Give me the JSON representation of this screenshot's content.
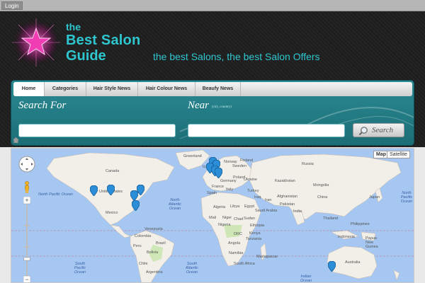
{
  "topbar": {
    "login_label": "Login"
  },
  "logo": {
    "line_the": "the",
    "line_1": "Best Salon",
    "line_2": "Guide",
    "icon": "pink-star-logo"
  },
  "tagline": "the best Salons, the best Salon Offers",
  "nav": [
    {
      "label": "Home",
      "active": true
    },
    {
      "label": "Categories",
      "active": false
    },
    {
      "label": "Hair Style News",
      "active": false
    },
    {
      "label": "Hair Colour News",
      "active": false
    },
    {
      "label": "Beaufy News",
      "active": false
    }
  ],
  "search": {
    "search_for_label": "Search For",
    "near_label": "Near",
    "near_hint": "(city, country)",
    "search_for_value": "",
    "near_value": "",
    "button_label": "Search"
  },
  "map": {
    "type_buttons": [
      "Map",
      "Satellite"
    ],
    "active_type": "Map",
    "oceans": [
      "North Pacific Ocean",
      "North Atlantic Ocean",
      "South Atlantic Ocean",
      "Indian Ocean",
      "North Pacific Ocean",
      "South Pacific Ocean"
    ],
    "countries": [
      "Canada",
      "United States",
      "Mexico",
      "Venezuela",
      "Colombia",
      "Peru",
      "Brazil",
      "Bolivia",
      "Chile",
      "Argentina",
      "Greenland",
      "Iceland",
      "Norway",
      "Sweden",
      "Finland",
      "Russia",
      "Germany",
      "Poland",
      "Ukraine",
      "France",
      "Spain",
      "Italy",
      "Turkey",
      "Kazakhstan",
      "Mongolia",
      "China",
      "Afghanistan",
      "Iran",
      "Iraq",
      "Pakistan",
      "India",
      "Algeria",
      "Libya",
      "Egypt",
      "Saudi Arabia",
      "Mali",
      "Niger",
      "Chad",
      "Sudan",
      "Nigeria",
      "Ethiopia",
      "DRC",
      "Kenya",
      "Tanzania",
      "Angola",
      "Namibia",
      "South Africa",
      "Madagascar",
      "Thailand",
      "Indonesia",
      "Papua New Guinea",
      "Australia",
      "Japan",
      "Philippines"
    ],
    "colors": {
      "water": "#a5c7f2",
      "land": "#f2efe9",
      "park": "#cfe6b6",
      "pin": "#2d8ed8"
    }
  }
}
